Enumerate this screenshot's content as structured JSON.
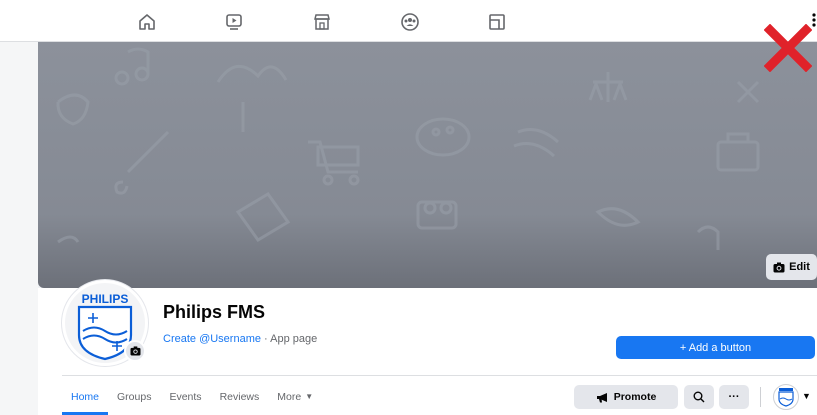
{
  "topbar": {
    "nav_icons": [
      "home-icon",
      "watch-icon",
      "marketplace-icon",
      "groups-icon",
      "gaming-icon"
    ],
    "menu_icon": "kebab-icon",
    "overlay_icon": "red-x-icon"
  },
  "cover": {
    "edit_label": "Edit"
  },
  "profile": {
    "name": "Philips FMS",
    "username_link": "Create @Username",
    "separator": " · ",
    "category": "App page",
    "logo_text": "PHILIPS"
  },
  "actions": {
    "add_button": "+ Add a button",
    "promote": "Promote",
    "more": "···"
  },
  "tabs": [
    {
      "label": "Home",
      "active": true
    },
    {
      "label": "Groups",
      "active": false
    },
    {
      "label": "Events",
      "active": false
    },
    {
      "label": "Reviews",
      "active": false
    },
    {
      "label": "More",
      "active": false
    }
  ],
  "colors": {
    "accent": "#1877f2",
    "danger": "#e0222a"
  }
}
